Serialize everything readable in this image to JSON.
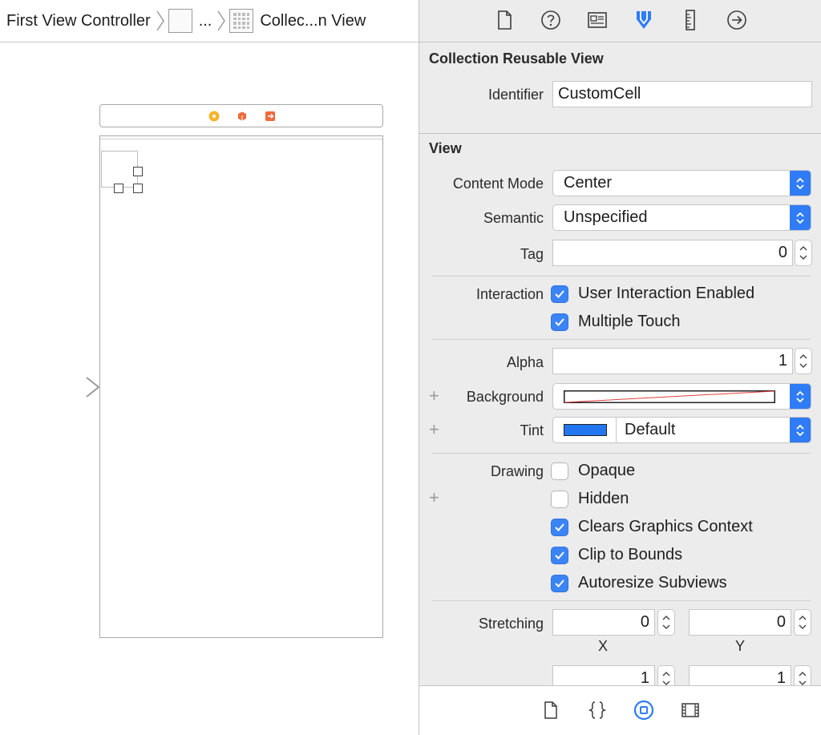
{
  "breadcrumb": {
    "first": "First View Controller",
    "ellipsis": "...",
    "last": "Collec...n View"
  },
  "toolbar": {
    "icons": [
      "file-inspector-icon",
      "quick-help-icon",
      "identity-inspector-icon",
      "attributes-inspector-icon",
      "size-inspector-icon",
      "connections-inspector-icon"
    ],
    "active": "attributes-inspector-icon",
    "accent": "#2f7cf6"
  },
  "collection_reusable_view": {
    "title": "Collection Reusable View",
    "identifier_label": "Identifier",
    "identifier_value": "CustomCell"
  },
  "view": {
    "title": "View",
    "content_mode_label": "Content Mode",
    "content_mode_value": "Center",
    "semantic_label": "Semantic",
    "semantic_value": "Unspecified",
    "tag_label": "Tag",
    "tag_value": "0",
    "interaction_label": "Interaction",
    "user_interaction": "User Interaction Enabled",
    "multiple_touch": "Multiple Touch",
    "alpha_label": "Alpha",
    "alpha_value": "1",
    "background_label": "Background",
    "tint_label": "Tint",
    "tint_value": "Default",
    "tint_color": "#2277f0",
    "plus": "+",
    "drawing_label": "Drawing",
    "opaque": "Opaque",
    "hidden": "Hidden",
    "clears_graphics": "Clears Graphics Context",
    "clip_to_bounds": "Clip to Bounds",
    "autoresize": "Autoresize Subviews",
    "stretching_label": "Stretching",
    "stretch_x": "0",
    "stretch_y": "0",
    "x_label": "X",
    "y_label": "Y",
    "stretch_w": "1",
    "stretch_h": "1"
  }
}
